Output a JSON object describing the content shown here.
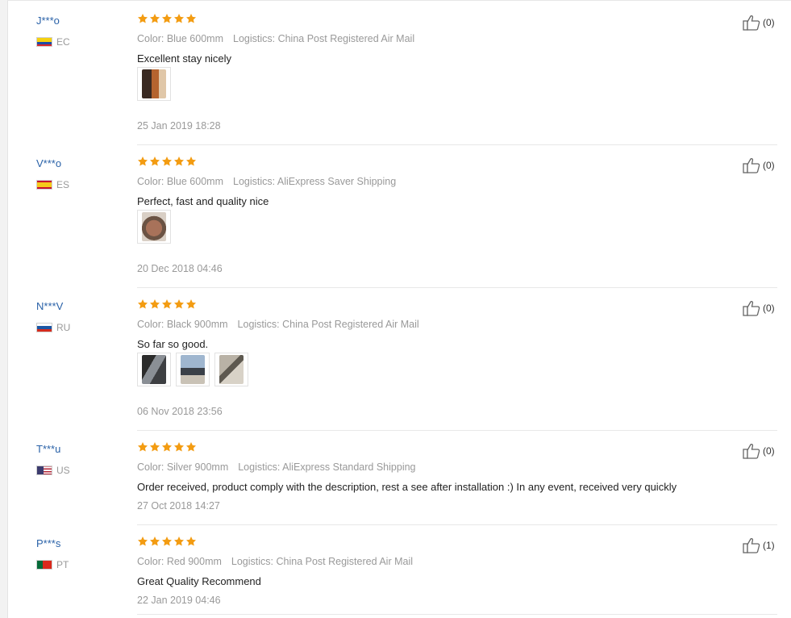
{
  "reviews": [
    {
      "user": "J***o",
      "country": "EC",
      "rating": 5,
      "color": "Color: Blue 600mm",
      "logistics": "Logistics: China Post Registered Air Mail",
      "text": "Excellent stay nicely",
      "photos": 1,
      "date": "25 Jan 2019 18:28",
      "helpful": "(0)"
    },
    {
      "user": "V***o",
      "country": "ES",
      "rating": 5,
      "color": "Color: Blue 600mm",
      "logistics": "Logistics: AliExpress Saver Shipping",
      "text": "Perfect, fast and quality nice",
      "photos": 1,
      "date": "20 Dec 2018 04:46",
      "helpful": "(0)"
    },
    {
      "user": "N***V",
      "country": "RU",
      "rating": 5,
      "color": "Color: Black 900mm",
      "logistics": "Logistics: China Post Registered Air Mail",
      "text": "So far so good.",
      "photos": 3,
      "date": "06 Nov 2018 23:56",
      "helpful": "(0)"
    },
    {
      "user": "T***u",
      "country": "US",
      "rating": 5,
      "color": "Color: Silver 900mm",
      "logistics": "Logistics: AliExpress Standard Shipping",
      "text": "Order received, product comply with the description, rest a see after installation :) In any event, received very quickly",
      "photos": 0,
      "date": "27 Oct 2018 14:27",
      "helpful": "(0)"
    },
    {
      "user": "P***s",
      "country": "PT",
      "rating": 5,
      "color": "Color: Red 900mm",
      "logistics": "Logistics: China Post Registered Air Mail",
      "text": "Great Quality Recommend",
      "photos": 0,
      "date": "22 Jan 2019 04:46",
      "helpful": "(1)"
    }
  ],
  "colors": {
    "username": "#2a62a8",
    "star": "#f39c12",
    "meta": "#999999",
    "text": "#222222"
  }
}
